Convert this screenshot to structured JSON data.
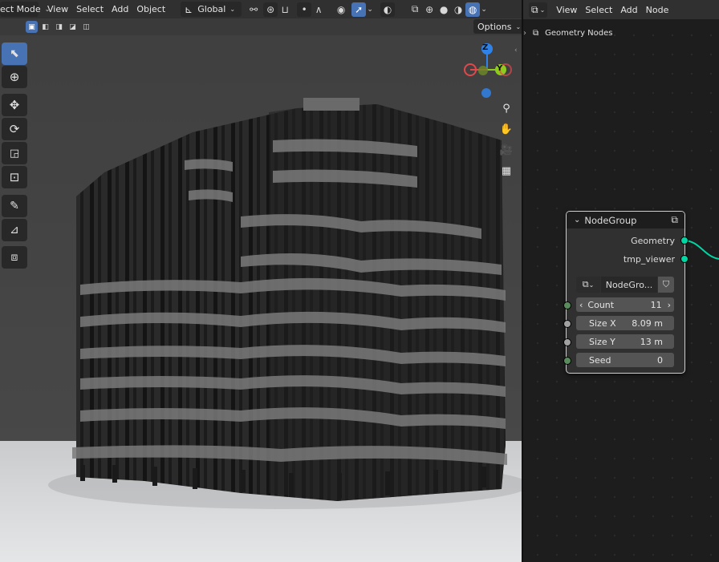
{
  "viewport": {
    "header": {
      "mode_label": "ect Mode",
      "menu": [
        "View",
        "Select",
        "Add",
        "Object"
      ],
      "transform_orientation": "Global",
      "options_label": "Options"
    },
    "gizmo": {
      "z": "Z",
      "y": "Y",
      "x": "X"
    }
  },
  "node_editor": {
    "menu": [
      "View",
      "Select",
      "Add",
      "Node"
    ],
    "breadcrumb": "Geometry Nodes",
    "node": {
      "title": "NodeGroup",
      "outputs": [
        "Geometry",
        "tmp_viewer"
      ],
      "group_name": "NodeGro...",
      "inputs": [
        {
          "label": "Count",
          "value": "11"
        },
        {
          "label": "Size X",
          "value": "8.09 m"
        },
        {
          "label": "Size Y",
          "value": "13 m"
        },
        {
          "label": "Seed",
          "value": "0"
        }
      ]
    }
  },
  "colors": {
    "accent": "#4772b3",
    "socket_geometry": "#00d6a3",
    "socket_int": "#598c5c",
    "socket_float": "#a1a1a1",
    "axis_x": "#e0484b",
    "axis_y": "#8ecb1f",
    "axis_z": "#2f83e8"
  }
}
